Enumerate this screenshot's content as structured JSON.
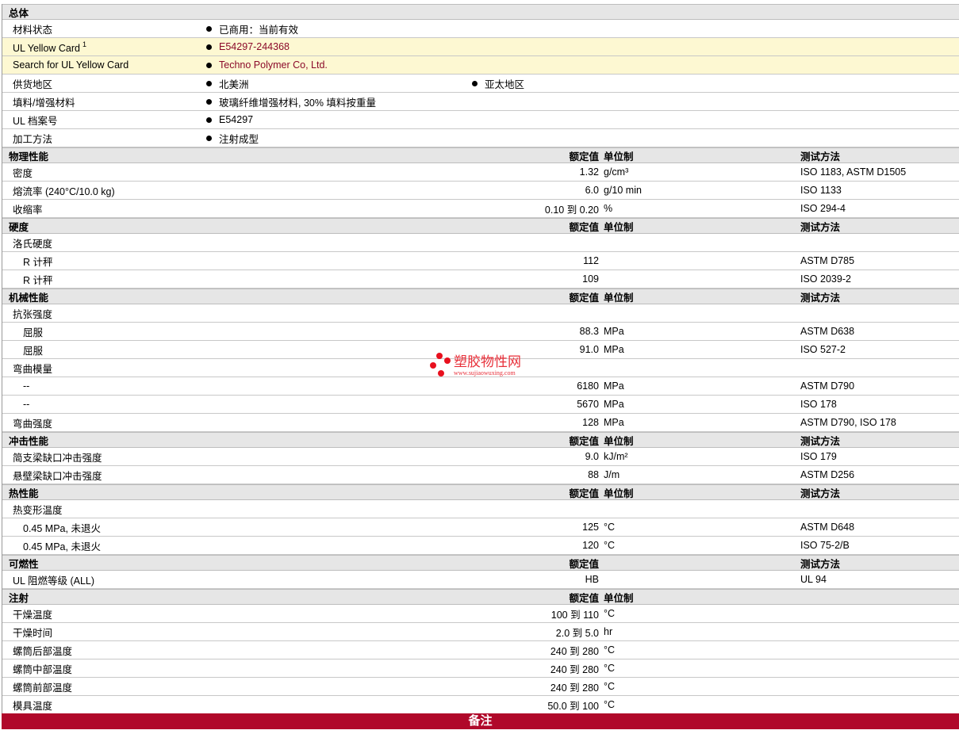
{
  "general": {
    "title": "总体",
    "rows": [
      {
        "name": "材料状态",
        "values": [
          "已商用：当前有效"
        ]
      },
      {
        "name": "UL Yellow Card",
        "sup": "1",
        "values": [
          "E54297-244368"
        ],
        "highlight": true,
        "link": true
      },
      {
        "name": "Search for UL Yellow Card",
        "values": [
          "Techno Polymer Co, Ltd."
        ],
        "highlight": true,
        "link": true
      },
      {
        "name": "供货地区",
        "values": [
          "北美洲",
          "亚太地区"
        ]
      },
      {
        "name": "填料/增强材料",
        "values": [
          "玻璃纤维增强材料, 30% 填料按重量"
        ]
      },
      {
        "name": "UL 档案号",
        "values": [
          "E54297"
        ]
      },
      {
        "name": "加工方法",
        "values": [
          "注射成型"
        ]
      }
    ]
  },
  "sections": [
    {
      "title": "物理性能",
      "col_value": "额定值",
      "col_unit": "单位制",
      "col_method": "测试方法",
      "rows": [
        {
          "name": "密度",
          "value": "1.32",
          "unit": "g/cm³",
          "method": "ISO 1183, ASTM D1505"
        },
        {
          "name": "熔流率  (240°C/10.0 kg)",
          "value": "6.0",
          "unit": "g/10 min",
          "method": "ISO 1133"
        },
        {
          "name": "收缩率",
          "value": "0.10 到  0.20",
          "unit": "%",
          "method": "ISO 294-4"
        }
      ]
    },
    {
      "title": "硬度",
      "col_value": "额定值",
      "col_unit": "单位制",
      "col_method": "测试方法",
      "rows": [
        {
          "name": "洛氏硬度"
        },
        {
          "name": "R 计秤",
          "indent": true,
          "value": "112",
          "unit": "",
          "method": "ASTM D785"
        },
        {
          "name": "R 计秤",
          "indent": true,
          "value": "109",
          "unit": "",
          "method": "ISO 2039-2"
        }
      ]
    },
    {
      "title": "机械性能",
      "col_value": "额定值",
      "col_unit": "单位制",
      "col_method": "测试方法",
      "rows": [
        {
          "name": "抗张强度"
        },
        {
          "name": "屈服",
          "indent": true,
          "value": "88.3",
          "unit": "MPa",
          "method": "ASTM D638"
        },
        {
          "name": "屈服",
          "indent": true,
          "value": "91.0",
          "unit": "MPa",
          "method": "ISO 527-2"
        },
        {
          "name": "弯曲模量"
        },
        {
          "name": "--",
          "indent": true,
          "value": "6180",
          "unit": "MPa",
          "method": "ASTM D790"
        },
        {
          "name": "--",
          "indent": true,
          "value": "5670",
          "unit": "MPa",
          "method": "ISO 178"
        },
        {
          "name": "弯曲强度",
          "value": "128",
          "unit": "MPa",
          "method": "ASTM D790, ISO 178"
        }
      ]
    },
    {
      "title": "冲击性能",
      "col_value": "额定值",
      "col_unit": "单位制",
      "col_method": "测试方法",
      "rows": [
        {
          "name": "简支梁缺口冲击强度",
          "value": "9.0",
          "unit": "kJ/m²",
          "method": "ISO 179"
        },
        {
          "name": "悬壁梁缺口冲击强度",
          "value": "88",
          "unit": "J/m",
          "method": "ASTM D256"
        }
      ]
    },
    {
      "title": "热性能",
      "col_value": "额定值",
      "col_unit": "单位制",
      "col_method": "测试方法",
      "rows": [
        {
          "name": "热变形温度"
        },
        {
          "name": "0.45 MPa, 未退火",
          "indent": true,
          "value": "125",
          "unit": "°C",
          "method": "ASTM D648"
        },
        {
          "name": "0.45 MPa, 未退火",
          "indent": true,
          "value": "120",
          "unit": "°C",
          "method": "ISO 75-2/B"
        }
      ]
    },
    {
      "title": "可燃性",
      "col_value": "额定值",
      "col_unit": "",
      "col_method": "测试方法",
      "rows": [
        {
          "name": "UL 阻燃等级  (ALL)",
          "value": "HB",
          "unit": "",
          "method": "UL 94"
        }
      ]
    },
    {
      "title": "注射",
      "col_value": "额定值",
      "col_unit": "单位制",
      "col_method": "",
      "rows": [
        {
          "name": "干燥温度",
          "value": "100 到  110",
          "unit": "°C",
          "method": ""
        },
        {
          "name": "干燥时间",
          "value": "2.0 到  5.0",
          "unit": "hr",
          "method": ""
        },
        {
          "name": "螺筒后部温度",
          "value": "240 到  280",
          "unit": "°C",
          "method": ""
        },
        {
          "name": "螺筒中部温度",
          "value": "240 到  280",
          "unit": "°C",
          "method": ""
        },
        {
          "name": "螺筒前部温度",
          "value": "240 到  280",
          "unit": "°C",
          "method": ""
        },
        {
          "name": "模具温度",
          "value": "50.0 到  100",
          "unit": "°C",
          "method": ""
        }
      ]
    }
  ],
  "footer": {
    "label": "备注"
  },
  "watermark": {
    "name": "塑胶物性网",
    "url": "www.sujiaowuxing.com"
  },
  "colors": {
    "link": "#8b0a2a",
    "footer": "#b0082a",
    "highlight": "#fdf8d2"
  }
}
